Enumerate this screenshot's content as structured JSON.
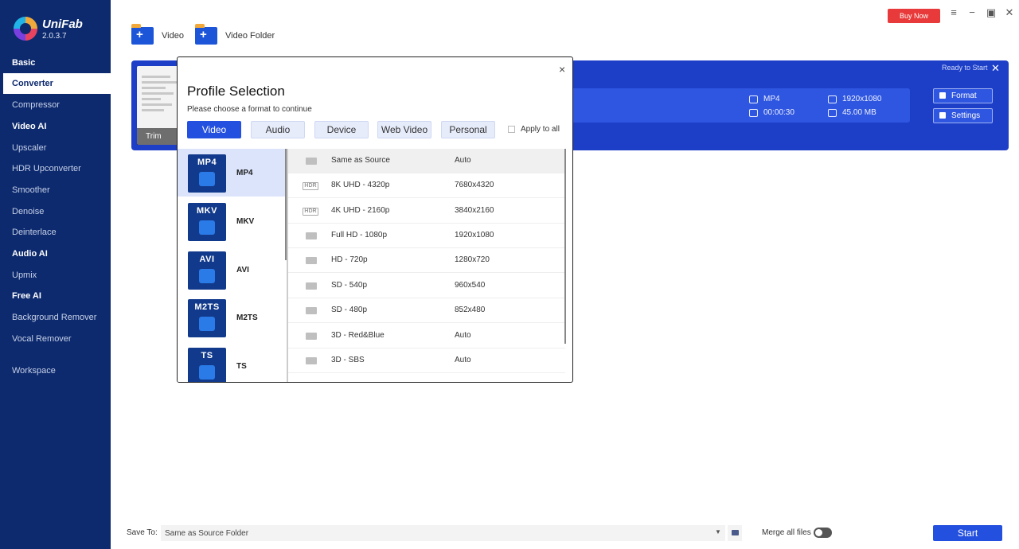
{
  "app": {
    "name": "UniFab",
    "version": "2.0.3.7"
  },
  "sidebar": {
    "sections": [
      {
        "label": "Basic"
      },
      {
        "label": "Video AI"
      },
      {
        "label": "Audio AI"
      },
      {
        "label": "Free AI"
      }
    ],
    "items": [
      {
        "label": "Converter"
      },
      {
        "label": "Compressor"
      },
      {
        "label": "Upscaler"
      },
      {
        "label": "HDR Upconverter"
      },
      {
        "label": "Smoother"
      },
      {
        "label": "Denoise"
      },
      {
        "label": "Deinterlace"
      },
      {
        "label": "Upmix"
      },
      {
        "label": "Background Remover"
      },
      {
        "label": "Vocal Remover"
      },
      {
        "label": "Workspace"
      }
    ]
  },
  "header": {
    "buy_label": "Buy Now",
    "menu_icon": "≡",
    "minimize_icon": "−",
    "restore_icon": "▣",
    "close_icon": "✕"
  },
  "toolbar": {
    "video_label": "Video",
    "folder_label": "Video Folder"
  },
  "task": {
    "status": "Ready to Start",
    "trim_label": "Trim",
    "format": "MP4",
    "resolution": "1920x1080",
    "duration": "00:00:30",
    "size": "45.00 MB",
    "format_btn": "Format",
    "settings_btn": "Settings",
    "close_icon": "✕"
  },
  "modal": {
    "title": "Profile Selection",
    "subtitle": "Please choose a format to continue",
    "close_icon": "×",
    "tabs": [
      "Video",
      "Audio",
      "Device",
      "Web Video",
      "Personal"
    ],
    "apply_label": "Apply to all",
    "formats": [
      {
        "badge": "MP4",
        "label": "MP4"
      },
      {
        "badge": "MKV",
        "label": "MKV"
      },
      {
        "badge": "AVI",
        "label": "AVI"
      },
      {
        "badge": "M2TS",
        "label": "M2TS"
      },
      {
        "badge": "TS",
        "label": "TS"
      }
    ],
    "hdr_badge": "HDR",
    "resolutions": [
      {
        "name": "Same as Source",
        "value": "Auto"
      },
      {
        "name": "8K UHD - 4320p",
        "value": "7680x4320"
      },
      {
        "name": "4K UHD - 2160p",
        "value": "3840x2160"
      },
      {
        "name": "Full HD - 1080p",
        "value": "1920x1080"
      },
      {
        "name": "HD - 720p",
        "value": "1280x720"
      },
      {
        "name": "SD - 540p",
        "value": "960x540"
      },
      {
        "name": "SD - 480p",
        "value": "852x480"
      },
      {
        "name": "3D - Red&Blue",
        "value": "Auto"
      },
      {
        "name": "3D - SBS",
        "value": "Auto"
      }
    ]
  },
  "bottom": {
    "save_label": "Save To:",
    "save_value": "Same as Source Folder",
    "dropdown_icon": "▼",
    "merge_label": "Merge all files",
    "start_label": "Start"
  }
}
